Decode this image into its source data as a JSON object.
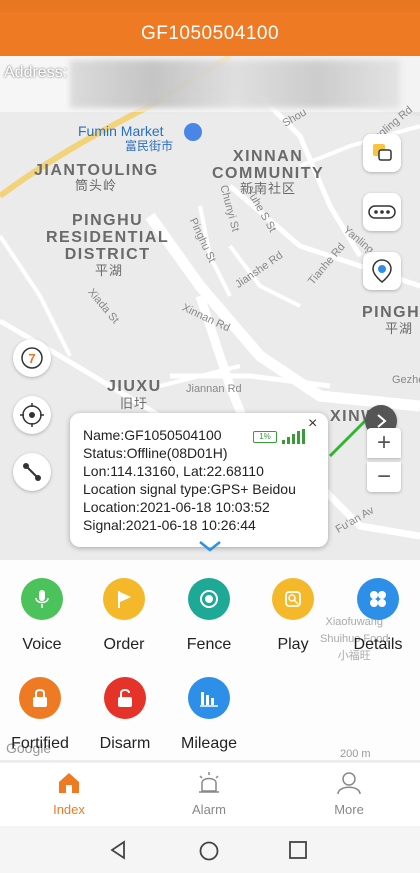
{
  "header": {
    "title": "GF1050504100"
  },
  "address": {
    "label": "Address:"
  },
  "map": {
    "labels": [
      {
        "key": "fumin_market",
        "text": "Fumin Market"
      },
      {
        "key": "fumin_market_cn",
        "text": "富民街市"
      },
      {
        "key": "jiantouling",
        "text": "JIANTOULING"
      },
      {
        "key": "jiantouling_cn",
        "text": "筒头岭"
      },
      {
        "key": "xinnan",
        "text": "XINNAN\nCOMMUNITY"
      },
      {
        "key": "xinnan_cn",
        "text": "新南社区"
      },
      {
        "key": "pinghu_res",
        "text": "PINGHU\nRESIDENTIAL\nDISTRICT"
      },
      {
        "key": "pinghu_res_cn",
        "text": "平湖"
      },
      {
        "key": "pinghu",
        "text": "PINGHU"
      },
      {
        "key": "pinghu_cn",
        "text": "平湖"
      },
      {
        "key": "jiuxu",
        "text": "JIUXU"
      },
      {
        "key": "jiuxu_cn",
        "text": "旧圩"
      },
      {
        "key": "xinwu",
        "text": "XINWU"
      },
      {
        "key": "pinghu_st",
        "text": "Pinghu St"
      },
      {
        "key": "xinnan_rd",
        "text": "Xinnan Rd"
      },
      {
        "key": "jiannan_rd",
        "text": "Jiannan Rd"
      },
      {
        "key": "xiada_st",
        "text": "Xiada St"
      },
      {
        "key": "chunyi_st",
        "text": "Chunyi St"
      },
      {
        "key": "yuhe_s_st",
        "text": "Yuhe S St"
      },
      {
        "key": "jianshe_rd",
        "text": "Jianshe Rd"
      },
      {
        "key": "tianhe_rd",
        "text": "Tianhe Rd"
      },
      {
        "key": "yanling",
        "text": "Yanling"
      },
      {
        "key": "fuan_av",
        "text": "Fu'an Av"
      },
      {
        "key": "hengling_rd",
        "text": "Hengling Rd"
      },
      {
        "key": "shou",
        "text": "Shou"
      },
      {
        "key": "gezhe",
        "text": "Gezhe"
      },
      {
        "key": "xiaofuwang",
        "text": "Xiaofuwang\nShuihuo Food\n小福旺"
      },
      {
        "key": "scale",
        "text": "200 m"
      },
      {
        "key": "google",
        "text": "Google"
      }
    ],
    "zoom_in_label": "+",
    "zoom_out_label": "−",
    "replay_number": "7"
  },
  "popup": {
    "name": "Name:GF1050504100",
    "status": "Status:Offline(08D01H)",
    "lonlat": "Lon:114.13160, Lat:22.68110",
    "signal_type": "Location signal type:GPS+ Beidou",
    "location": "Location:2021-06-18 10:03:52",
    "signal": "Signal:2021-06-18 10:26:44",
    "battery": "1%",
    "close": "×"
  },
  "functions": [
    {
      "label": "Voice",
      "color": "#4cc35a",
      "icon": "microphone-icon"
    },
    {
      "label": "Order",
      "color": "#f5b82a",
      "icon": "flag-icon"
    },
    {
      "label": "Fence",
      "color": "#1ea896",
      "icon": "fence-icon"
    },
    {
      "label": "Play",
      "color": "#f5b82a",
      "icon": "playback-icon"
    },
    {
      "label": "Details",
      "color": "#2e8fe8",
      "icon": "details-icon"
    },
    {
      "label": "Fortified",
      "color": "#ee7a24",
      "icon": "lock-icon"
    },
    {
      "label": "Disarm",
      "color": "#e5332a",
      "icon": "unlock-icon"
    },
    {
      "label": "Mileage",
      "color": "#2e8fe8",
      "icon": "chart-icon"
    }
  ],
  "tabs": [
    {
      "label": "Index",
      "active": true
    },
    {
      "label": "Alarm",
      "active": false
    },
    {
      "label": "More",
      "active": false
    }
  ],
  "colors": {
    "accent": "#ee7a24",
    "active_tab": "#ee7a24",
    "inactive_tab": "#888888"
  }
}
